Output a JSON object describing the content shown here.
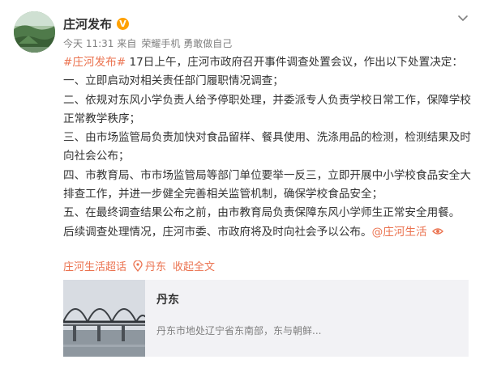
{
  "post": {
    "author": "庄河发布",
    "verified_badge": "V",
    "meta": {
      "time": "今天 11:31",
      "source_prefix": "来自",
      "source": "荣耀手机 勇敢做自己"
    },
    "content": {
      "topic": "#庄河发布#",
      "intro": " 17日上午，庄河市政府召开事件调查处置会议，作出以下处置决定：",
      "items": [
        "一、立即启动对相关责任部门履职情况调查；",
        "二、依规对东风小学负责人给予停职处理，并委派专人负责学校日常工作，保障学校正常教学秩序；",
        "三、由市场监管局负责加快对食品留样、餐具使用、洗涤用品的检测，检测结果及时向社会公布；",
        "四、市教育局、市市场监管局等部门单位要举一反三，立即开展中小学校食品安全大排查工作，并进一步健全完善相关监管机制，确保学校食品安全；",
        "五、在最终调查结果公布之前，由市教育局负责保障东风小学师生正常安全用餐。"
      ],
      "closing": "后续调查处理情况，庄河市委、市政府将及时向社会予以公布。",
      "mention": "@庄河生活"
    },
    "footer": {
      "supertopic": "庄河生活超话",
      "location": "丹东",
      "collapse": "收起全文"
    },
    "card": {
      "title": "丹东",
      "description": "丹东市地处辽宁省东南部，东与朝鲜..."
    },
    "colors": {
      "link": "#eb7350",
      "badge": "#ffa100",
      "meta": "#808080",
      "card_bg": "#f2f2f5"
    },
    "icons": {
      "menu": "chevron-down-icon",
      "weibo_link": "link-icon",
      "location": "location-pin-icon"
    }
  }
}
